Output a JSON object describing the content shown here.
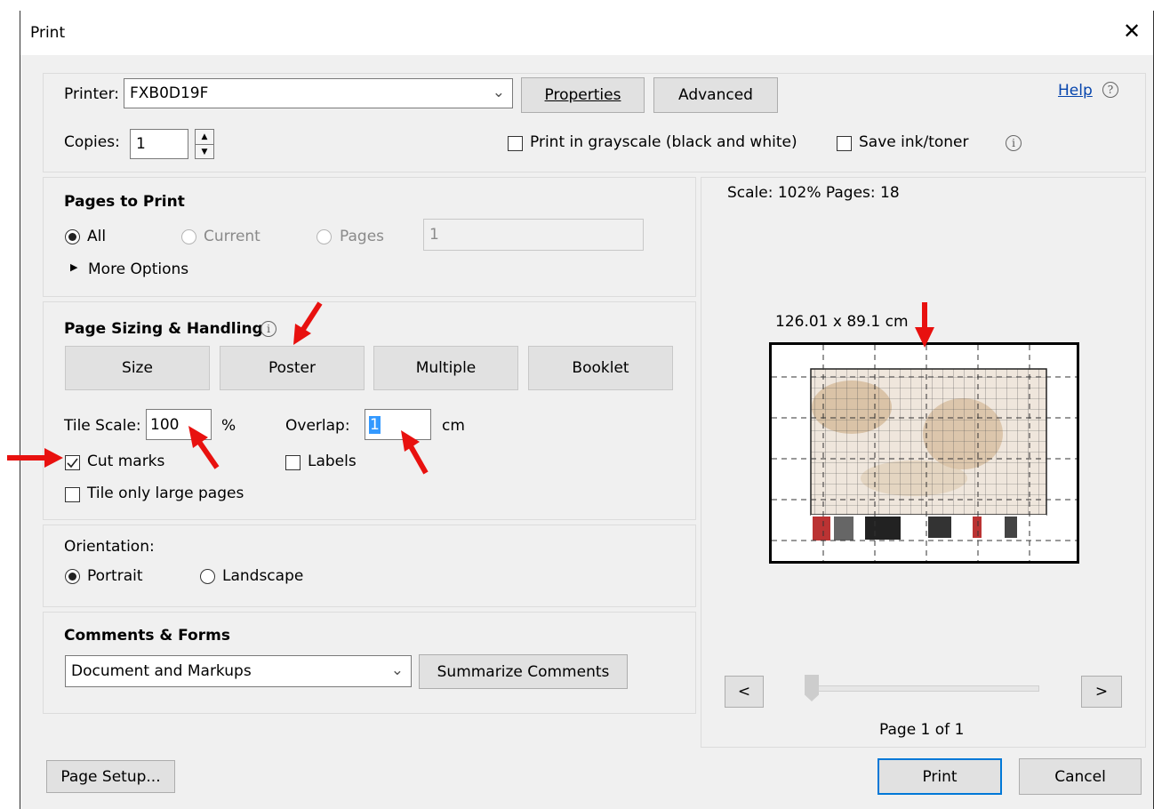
{
  "window": {
    "title": "Print",
    "close_glyph": "✕",
    "background": "#f0f0f0",
    "arrow_color": "#e8110f"
  },
  "printer": {
    "label": "Printer:",
    "value": "FXB0D19F",
    "properties_label": "Properties",
    "advanced_label": "Advanced",
    "help_label": "Help",
    "help_icon": "question-circle-icon",
    "copies_label": "Copies:",
    "copies_value": "1",
    "grayscale_label": "Print in grayscale (black and white)",
    "grayscale_checked": false,
    "save_ink_label": "Save ink/toner",
    "save_ink_checked": false,
    "info_icon": "info-circle-icon"
  },
  "pages_to_print": {
    "heading": "Pages to Print",
    "options": [
      {
        "label": "All",
        "selected": true,
        "enabled": true
      },
      {
        "label": "Current",
        "selected": false,
        "enabled": false
      },
      {
        "label": "Pages",
        "selected": false,
        "enabled": false
      }
    ],
    "pages_value": "1",
    "more_options_label": "More Options"
  },
  "page_sizing": {
    "heading": "Page Sizing & Handling",
    "modes": [
      "Size",
      "Poster",
      "Multiple",
      "Booklet"
    ],
    "active_mode": "Poster",
    "tile_scale_label": "Tile Scale:",
    "tile_scale_value": "100",
    "tile_scale_unit": "%",
    "overlap_label": "Overlap:",
    "overlap_value": "1",
    "overlap_unit": "cm",
    "cut_marks_label": "Cut marks",
    "cut_marks_checked": true,
    "labels_label": "Labels",
    "labels_checked": false,
    "tile_large_label": "Tile only large pages",
    "tile_large_checked": false
  },
  "orientation": {
    "heading": "Orientation:",
    "options": [
      {
        "label": "Portrait",
        "selected": true
      },
      {
        "label": "Landscape",
        "selected": false
      }
    ]
  },
  "comments_forms": {
    "heading": "Comments & Forms",
    "selected": "Document and Markups",
    "summarize_label": "Summarize Comments"
  },
  "preview": {
    "scale_text": "Scale: 102% Pages: 18",
    "dimensions": "126.01 x 89.1 cm",
    "prev_label": "<",
    "next_label": ">",
    "page_indicator": "Page 1 of 1"
  },
  "footer": {
    "page_setup_label": "Page Setup...",
    "print_label": "Print",
    "cancel_label": "Cancel"
  }
}
